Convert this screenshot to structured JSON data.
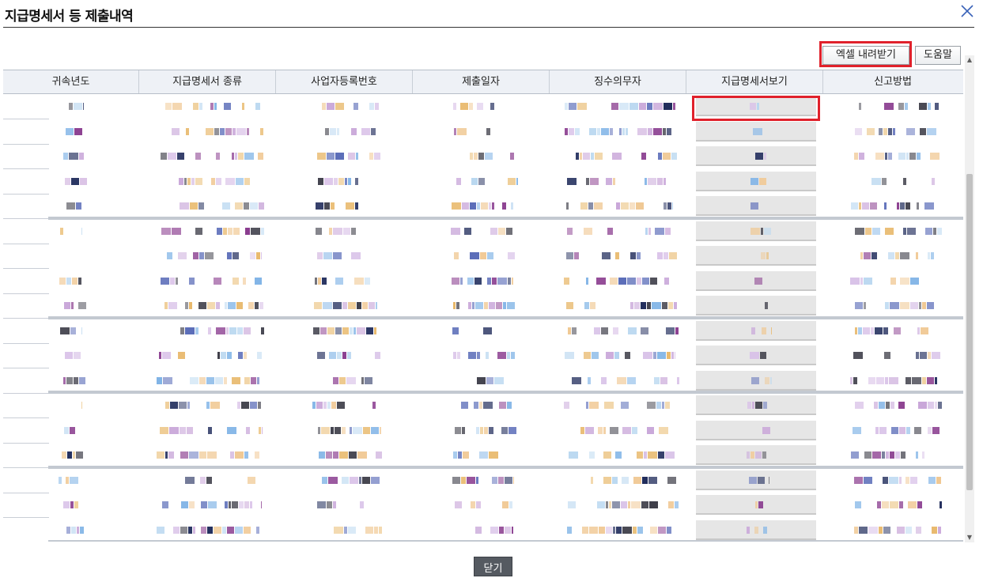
{
  "dialog": {
    "title": "지급명세서 등 제출내역",
    "close_icon": "close-icon"
  },
  "toolbar": {
    "excel_label": "엑셀 내려받기",
    "help_label": "도움말"
  },
  "grid": {
    "columns": [
      "귀속년도",
      "지급명세서 종류",
      "사업자등록번호",
      "제출일자",
      "징수의무자",
      "지급명세서보기",
      "신고방법"
    ],
    "row_count": 18,
    "masked": true
  },
  "footer": {
    "close_label": "닫기"
  },
  "colors": {
    "highlight": "#e0212b",
    "header_bg": "#eef1f6",
    "view_cell_bg": "#e6e6e6",
    "close_button_bg": "#555a61"
  }
}
